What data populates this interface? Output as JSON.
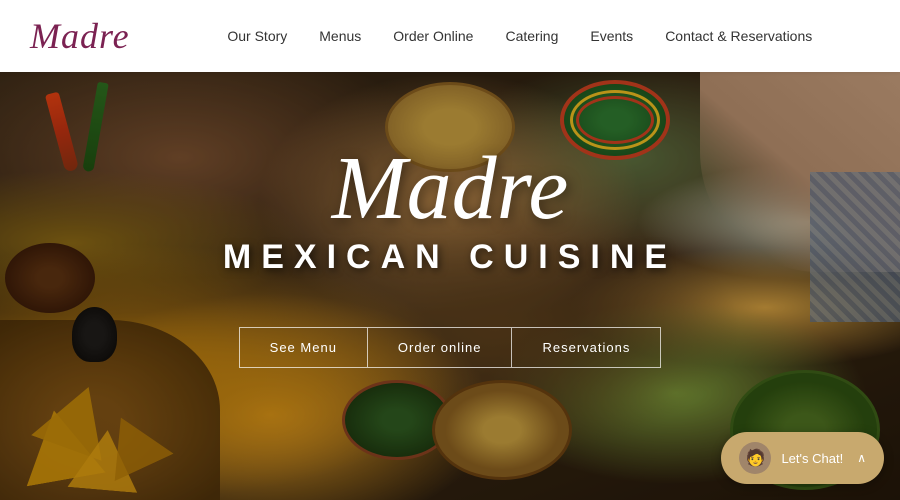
{
  "header": {
    "logo": "Madre",
    "nav": [
      {
        "label": "Our Story",
        "id": "our-story"
      },
      {
        "label": "Menus",
        "id": "menus"
      },
      {
        "label": "Order Online",
        "id": "order-online"
      },
      {
        "label": "Catering",
        "id": "catering"
      },
      {
        "label": "Events",
        "id": "events"
      },
      {
        "label": "Contact & Reservations",
        "id": "contact-reservations"
      }
    ]
  },
  "hero": {
    "brand": "Madre",
    "subtitle": "MEXICAN CUISINE",
    "cta_buttons": [
      {
        "label": "See Menu",
        "id": "see-menu"
      },
      {
        "label": "Order online",
        "id": "order-online-cta"
      },
      {
        "label": "Reservations",
        "id": "reservations-cta"
      }
    ]
  },
  "chat": {
    "label": "Let's Chat!",
    "chevron": "∧"
  }
}
